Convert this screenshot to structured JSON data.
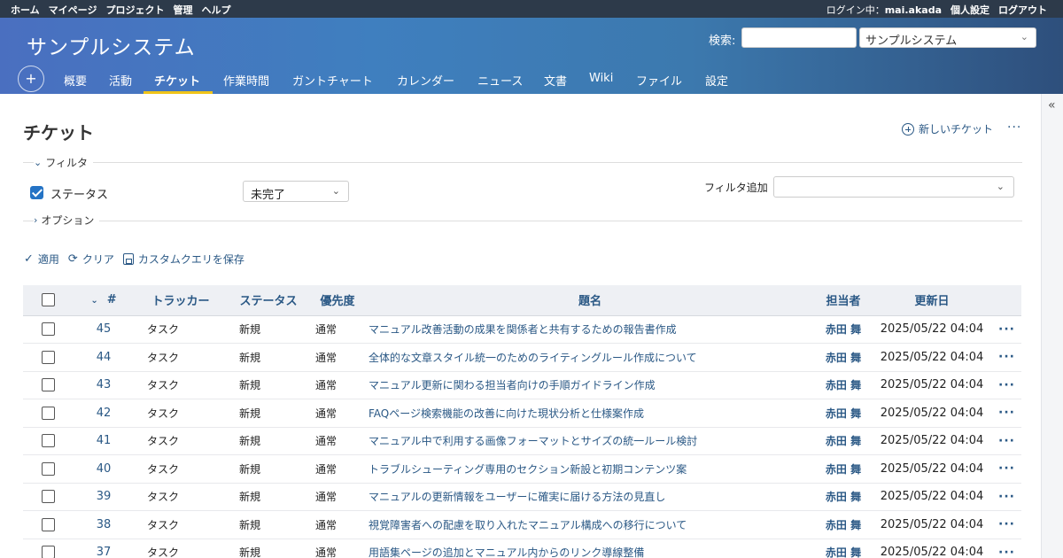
{
  "topbar": {
    "nav": [
      "ホーム",
      "マイページ",
      "プロジェクト",
      "管理",
      "ヘルプ"
    ],
    "login_label": "ログイン中：",
    "user": "mai.akada",
    "my_account": "個人設定",
    "logout": "ログアウト"
  },
  "header": {
    "title": "サンプルシステム",
    "search_label": "検索:",
    "search_value": "",
    "project_select": "サンプルシステム",
    "new_object": "+"
  },
  "tabs": [
    {
      "label": "概要"
    },
    {
      "label": "活動"
    },
    {
      "label": "チケット",
      "selected": true
    },
    {
      "label": "作業時間"
    },
    {
      "label": "ガントチャート"
    },
    {
      "label": "カレンダー"
    },
    {
      "label": "ニュース"
    },
    {
      "label": "文書"
    },
    {
      "label": "Wiki"
    },
    {
      "label": "ファイル"
    },
    {
      "label": "設定"
    }
  ],
  "page": {
    "title": "チケット",
    "new_issue": "新しいチケット",
    "more": "···"
  },
  "filters": {
    "legend": "フィルタ",
    "status_label": "ステータス",
    "status_checked": true,
    "status_operator": "未完了",
    "add_filter_label": "フィルタ追加",
    "add_filter_value": ""
  },
  "options": {
    "legend": "オプション"
  },
  "actions": {
    "apply": "適用",
    "clear": "クリア",
    "save_query": "カスタムクエリを保存"
  },
  "table": {
    "columns": {
      "id": "#",
      "tracker": "トラッカー",
      "status": "ステータス",
      "priority": "優先度",
      "subject": "題名",
      "assignee": "担当者",
      "updated": "更新日"
    },
    "rows": [
      {
        "id": "45",
        "tracker": "タスク",
        "status": "新規",
        "priority": "通常",
        "subject": "マニュアル改善活動の成果を関係者と共有するための報告書作成",
        "assignee": "赤田 舞",
        "updated": "2025/05/22 04:04"
      },
      {
        "id": "44",
        "tracker": "タスク",
        "status": "新規",
        "priority": "通常",
        "subject": "全体的な文章スタイル統一のためのライティングルール作成について",
        "assignee": "赤田 舞",
        "updated": "2025/05/22 04:04"
      },
      {
        "id": "43",
        "tracker": "タスク",
        "status": "新規",
        "priority": "通常",
        "subject": "マニュアル更新に関わる担当者向けの手順ガイドライン作成",
        "assignee": "赤田 舞",
        "updated": "2025/05/22 04:04"
      },
      {
        "id": "42",
        "tracker": "タスク",
        "status": "新規",
        "priority": "通常",
        "subject": "FAQページ検索機能の改善に向けた現状分析と仕様案作成",
        "assignee": "赤田 舞",
        "updated": "2025/05/22 04:04"
      },
      {
        "id": "41",
        "tracker": "タスク",
        "status": "新規",
        "priority": "通常",
        "subject": "マニュアル中で利用する画像フォーマットとサイズの統一ルール検討",
        "assignee": "赤田 舞",
        "updated": "2025/05/22 04:04"
      },
      {
        "id": "40",
        "tracker": "タスク",
        "status": "新規",
        "priority": "通常",
        "subject": "トラブルシューティング専用のセクション新設と初期コンテンツ案",
        "assignee": "赤田 舞",
        "updated": "2025/05/22 04:04"
      },
      {
        "id": "39",
        "tracker": "タスク",
        "status": "新規",
        "priority": "通常",
        "subject": "マニュアルの更新情報をユーザーに確実に届ける方法の見直し",
        "assignee": "赤田 舞",
        "updated": "2025/05/22 04:04"
      },
      {
        "id": "38",
        "tracker": "タスク",
        "status": "新規",
        "priority": "通常",
        "subject": "視覚障害者への配慮を取り入れたマニュアル構成への移行について",
        "assignee": "赤田 舞",
        "updated": "2025/05/22 04:04"
      },
      {
        "id": "37",
        "tracker": "タスク",
        "status": "新規",
        "priority": "通常",
        "subject": "用語集ページの追加とマニュアル内からのリンク導線整備",
        "assignee": "赤田 舞",
        "updated": "2025/05/22 04:04"
      }
    ]
  }
}
